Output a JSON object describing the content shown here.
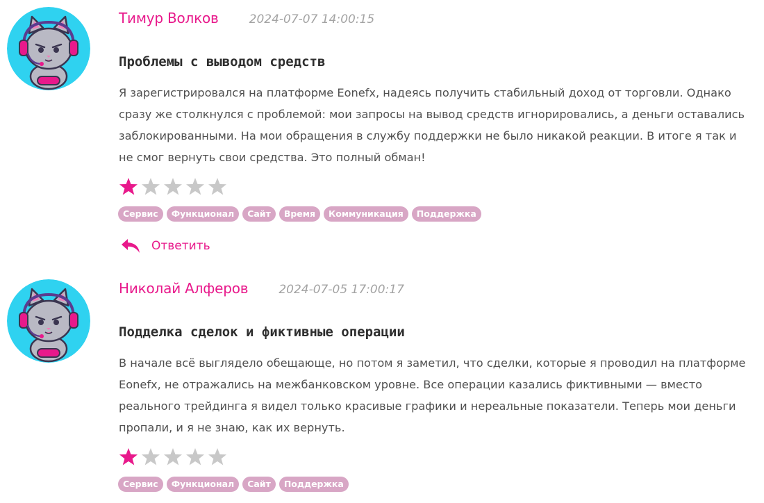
{
  "reviews": [
    {
      "author": "Тимур Волков",
      "date": "2024-07-07 14:00:15",
      "title": "Проблемы с выводом средств",
      "body": "Я зарегистрировался на платформе Eonefx, надеясь получить стабильный доход от торговли. Однако сразу же столкнулся с проблемой: мои запросы на вывод средств игнорировались, а деньги оставались заблокированными. На мои обращения в службу поддержки не было никакой реакции. В итоге я так и не смог вернуть свои средства. Это полный обман!",
      "rating": 1,
      "rating_max": 5,
      "tags": [
        "Сервис",
        "Функционал",
        "Сайт",
        "Время",
        "Коммуникация",
        "Поддержка"
      ],
      "reply_label": "Ответить"
    },
    {
      "author": "Николай Алферов",
      "date": "2024-07-05 17:00:17",
      "title": "Подделка сделок и фиктивные операции",
      "body": "В начале всё выглядело обещающе, но потом я заметил, что сделки, которые я проводил на платформе Eonefx, не отражались на межбанковском уровне. Все операции казались фиктивными — вместо реального трейдинга я видел только красивые графики и нереальные показатели. Теперь мои деньги пропали, и я не знаю, как их вернуть.",
      "rating": 1,
      "rating_max": 5,
      "tags": [
        "Сервис",
        "Функционал",
        "Сайт",
        "Поддержка"
      ]
    }
  ],
  "colors": {
    "accent": "#e8198b",
    "tag_bg": "#d8a6c5",
    "star_off": "#c8c8c8",
    "avatar_bg": "#2fd2f0"
  },
  "icons": {
    "avatar": "cat-gamer-avatar-icon",
    "star": "star-icon",
    "reply": "reply-arrow-icon"
  }
}
